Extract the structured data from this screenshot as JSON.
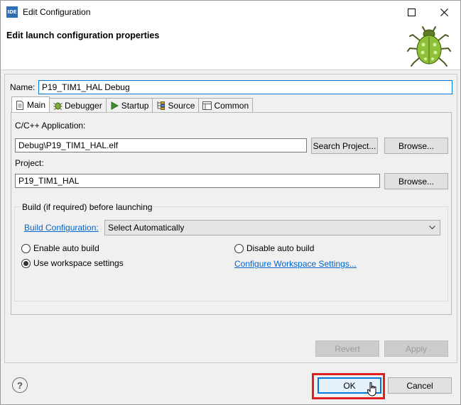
{
  "window": {
    "app_icon_text": "IDE",
    "title": "Edit Configuration"
  },
  "banner": {
    "title": "Edit launch configuration properties"
  },
  "name": {
    "label": "Name:",
    "value": "P19_TIM1_HAL Debug"
  },
  "tabs": [
    {
      "label": "Main",
      "icon": "main-tab-icon",
      "active": true
    },
    {
      "label": "Debugger",
      "icon": "debugger-tab-icon",
      "active": false
    },
    {
      "label": "Startup",
      "icon": "startup-tab-icon",
      "active": false
    },
    {
      "label": "Source",
      "icon": "source-tab-icon",
      "active": false
    },
    {
      "label": "Common",
      "icon": "common-tab-icon",
      "active": false
    }
  ],
  "main": {
    "app_label": "C/C++ Application:",
    "app_value": "Debug\\P19_TIM1_HAL.elf",
    "search_project_label": "Search Project...",
    "browse_label": "Browse...",
    "project_label": "Project:",
    "project_value": "P19_TIM1_HAL",
    "project_browse_label": "Browse...",
    "build_group": {
      "title": "Build (if required) before launching",
      "build_config_link": "Build Configuration:",
      "build_config_value": "Select Automatically",
      "enable_auto_build": "Enable auto build",
      "disable_auto_build": "Disable auto build",
      "use_workspace_settings": "Use workspace settings",
      "configure_workspace_link": "Configure Workspace Settings...",
      "selected_option": "Use workspace settings"
    }
  },
  "footer": {
    "revert_label": "Revert",
    "apply_label": "Apply",
    "ok_label": "OK",
    "cancel_label": "Cancel",
    "help_symbol": "?"
  },
  "colors": {
    "accent": "#0078d7",
    "link": "#0066cc",
    "highlight": "#e02020"
  }
}
